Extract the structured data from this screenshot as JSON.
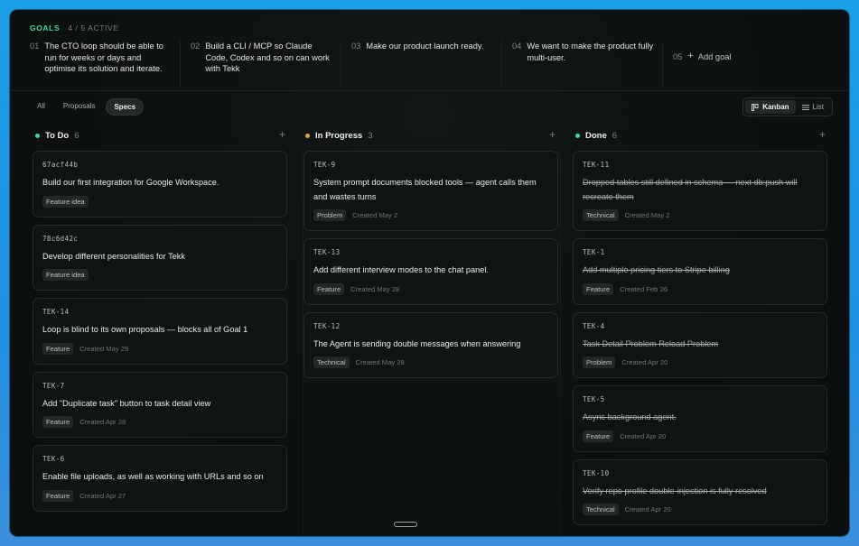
{
  "goals": {
    "label": "GOALS",
    "count": "4 / 5 ACTIVE",
    "items": [
      {
        "num": "01",
        "text": "The CTO loop should be able to run for weeks or days and optimise its solution and iterate."
      },
      {
        "num": "02",
        "text": "Build a CLI / MCP so Claude Code, Codex and so on can work with Tekk"
      },
      {
        "num": "03",
        "text": "Make our product launch ready."
      },
      {
        "num": "04",
        "text": "We want to make the product fully multi-user."
      }
    ],
    "add": {
      "num": "05",
      "label": "Add goal"
    }
  },
  "filters": {
    "all": "All",
    "proposals": "Proposals",
    "specs": "Specs"
  },
  "view": {
    "kanban": "Kanban",
    "list": "List"
  },
  "columns": [
    {
      "name": "To Do",
      "count": "6",
      "color": "#3fd6a6",
      "cards": [
        {
          "id": "67acf44b",
          "title": "Build our first integration for Google Workspace.",
          "tag": "Feature idea",
          "created": ""
        },
        {
          "id": "78c6d42c",
          "title": "Develop different personalities for Tekk",
          "tag": "Feature idea",
          "created": ""
        },
        {
          "id": "TEK-14",
          "title": "Loop is blind to its own proposals — blocks all of Goal 1",
          "tag": "Feature",
          "created": "Created May 29"
        },
        {
          "id": "TEK-7",
          "title": "Add \"Duplicate task\" button to task detail view",
          "tag": "Feature",
          "created": "Created Apr 28"
        },
        {
          "id": "TEK-6",
          "title": "Enable file uploads, as well as working with URLs and so on",
          "tag": "Feature",
          "created": "Created Apr 27"
        }
      ]
    },
    {
      "name": "In Progress",
      "count": "3",
      "color": "#e0a43a",
      "cards": [
        {
          "id": "TEK-9",
          "title": "System prompt documents blocked tools — agent calls them and wastes turns",
          "tag": "Problem",
          "created": "Created May 2"
        },
        {
          "id": "TEK-13",
          "title": "Add different interview modes to the chat panel.",
          "tag": "Feature",
          "created": "Created May 28"
        },
        {
          "id": "TEK-12",
          "title": "The Agent is sending double messages when answering",
          "tag": "Technical",
          "created": "Created May 28"
        }
      ]
    },
    {
      "name": "Done",
      "count": "6",
      "color": "#3fd6a6",
      "cards": [
        {
          "id": "TEK-11",
          "title": "Dropped tables still defined in schema — next db:push will recreate them",
          "tag": "Technical",
          "created": "Created May 2"
        },
        {
          "id": "TEK-1",
          "title": "Add multiple pricing tiers to Stripe billing",
          "tag": "Feature",
          "created": "Created Feb 26"
        },
        {
          "id": "TEK-4",
          "title": "Task Detail Problem Reload Problem",
          "tag": "Problem",
          "created": "Created Apr 20"
        },
        {
          "id": "TEK-5",
          "title": "Async background agent.",
          "tag": "Feature",
          "created": "Created Apr 20"
        },
        {
          "id": "TEK-10",
          "title": "Verify repo profile double-injection is fully resolved",
          "tag": "Technical",
          "created": "Created Apr 20"
        }
      ]
    }
  ]
}
